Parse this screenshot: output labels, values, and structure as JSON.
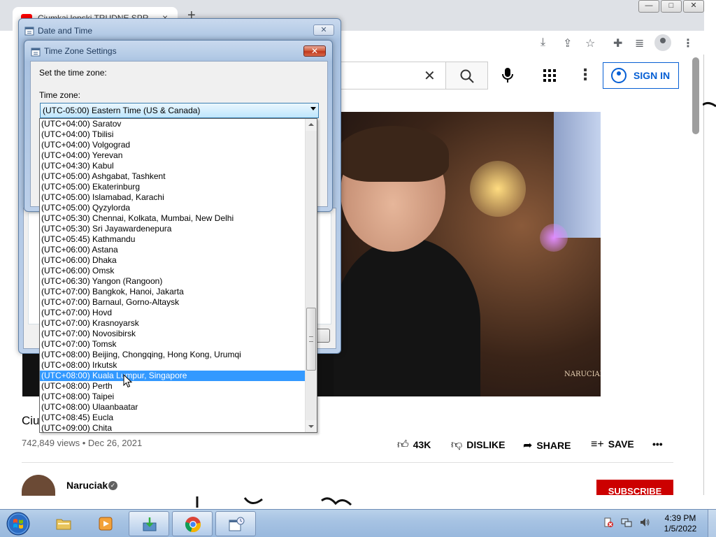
{
  "browser": {
    "tab_title": "Ciumkai lopski TRUDNE SPR...",
    "tab_close": "×",
    "new_tab": "+",
    "window_buttons": [
      "—",
      "□",
      "✕"
    ]
  },
  "youtube": {
    "signin_label": "SIGN IN",
    "video_title": "Ciu",
    "views": "742,849 views • Dec 26, 2021",
    "like_count": "43K",
    "dislike_label": "DISLIKE",
    "share_label": "SHARE",
    "save_label": "SAVE",
    "more_label": "•••",
    "channel_name": "Naruciak",
    "subscribe_label": "SUBSCRIBE",
    "watermark": "NARUCIAK"
  },
  "date_time_window": {
    "title": "Date and Time",
    "close_label": "✕"
  },
  "tz_window": {
    "title": "Time Zone Settings",
    "close_label": "✕",
    "set_label": "Set the time zone:",
    "tz_label": "Time zone:",
    "selected_value": "(UTC-05:00) Eastern Time (US & Canada)"
  },
  "tz_list": [
    {
      "label": "(UTC+04:00) Saratov",
      "selected": false
    },
    {
      "label": "(UTC+04:00) Tbilisi",
      "selected": false
    },
    {
      "label": "(UTC+04:00) Volgograd",
      "selected": false
    },
    {
      "label": "(UTC+04:00) Yerevan",
      "selected": false
    },
    {
      "label": "(UTC+04:30) Kabul",
      "selected": false
    },
    {
      "label": "(UTC+05:00) Ashgabat, Tashkent",
      "selected": false
    },
    {
      "label": "(UTC+05:00) Ekaterinburg",
      "selected": false
    },
    {
      "label": "(UTC+05:00) Islamabad, Karachi",
      "selected": false
    },
    {
      "label": "(UTC+05:00) Qyzylorda",
      "selected": false
    },
    {
      "label": "(UTC+05:30) Chennai, Kolkata, Mumbai, New Delhi",
      "selected": false
    },
    {
      "label": "(UTC+05:30) Sri Jayawardenepura",
      "selected": false
    },
    {
      "label": "(UTC+05:45) Kathmandu",
      "selected": false
    },
    {
      "label": "(UTC+06:00) Astana",
      "selected": false
    },
    {
      "label": "(UTC+06:00) Dhaka",
      "selected": false
    },
    {
      "label": "(UTC+06:00) Omsk",
      "selected": false
    },
    {
      "label": "(UTC+06:30) Yangon (Rangoon)",
      "selected": false
    },
    {
      "label": "(UTC+07:00) Bangkok, Hanoi, Jakarta",
      "selected": false
    },
    {
      "label": "(UTC+07:00) Barnaul, Gorno-Altaysk",
      "selected": false
    },
    {
      "label": "(UTC+07:00) Hovd",
      "selected": false
    },
    {
      "label": "(UTC+07:00) Krasnoyarsk",
      "selected": false
    },
    {
      "label": "(UTC+07:00) Novosibirsk",
      "selected": false
    },
    {
      "label": "(UTC+07:00) Tomsk",
      "selected": false
    },
    {
      "label": "(UTC+08:00) Beijing, Chongqing, Hong Kong, Urumqi",
      "selected": false
    },
    {
      "label": "(UTC+08:00) Irkutsk",
      "selected": false
    },
    {
      "label": "(UTC+08:00) Kuala Lumpur, Singapore",
      "selected": true
    },
    {
      "label": "(UTC+08:00) Perth",
      "selected": false
    },
    {
      "label": "(UTC+08:00) Taipei",
      "selected": false
    },
    {
      "label": "(UTC+08:00) Ulaanbaatar",
      "selected": false
    },
    {
      "label": "(UTC+08:45) Eucla",
      "selected": false
    },
    {
      "label": "(UTC+09:00) Chita",
      "selected": false
    }
  ],
  "taskbar": {
    "items": [
      {
        "name": "explorer-icon",
        "active": false
      },
      {
        "name": "media-player-icon",
        "active": false
      },
      {
        "name": "installer-icon",
        "active": true
      },
      {
        "name": "chrome-icon",
        "active": true
      },
      {
        "name": "date-time-icon",
        "active": true
      }
    ],
    "time": "4:39 PM",
    "date": "1/5/2022"
  },
  "colors": {
    "selection": "#3399ff",
    "youtube_blue": "#065fd4",
    "youtube_red": "#cc0000"
  }
}
